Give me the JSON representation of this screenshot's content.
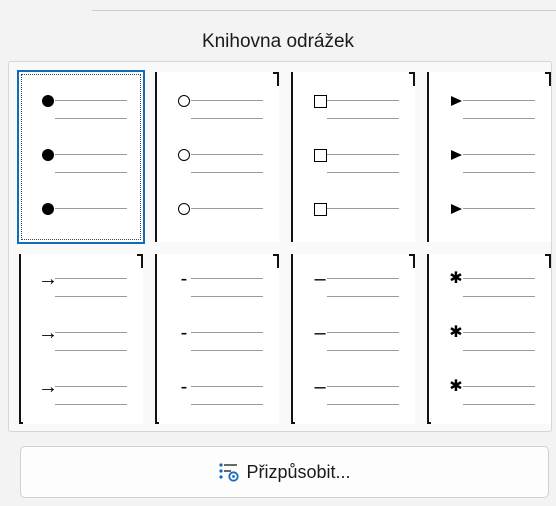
{
  "header": {
    "title": "Knihovna odrážek"
  },
  "gallery": {
    "tiles": [
      {
        "symbol": "filled-circle",
        "selected": true
      },
      {
        "symbol": "hollow-circle"
      },
      {
        "symbol": "hollow-square"
      },
      {
        "symbol": "arrowhead"
      },
      {
        "symbol": "arrow",
        "glyph": "→"
      },
      {
        "symbol": "dash-short",
        "glyph": "-"
      },
      {
        "symbol": "dash-long",
        "glyph": "–"
      },
      {
        "symbol": "asterisk",
        "glyph": "✱"
      }
    ]
  },
  "customize": {
    "label": "Přizpůsobit..."
  },
  "colors": {
    "accent": "#0f6cbd"
  }
}
